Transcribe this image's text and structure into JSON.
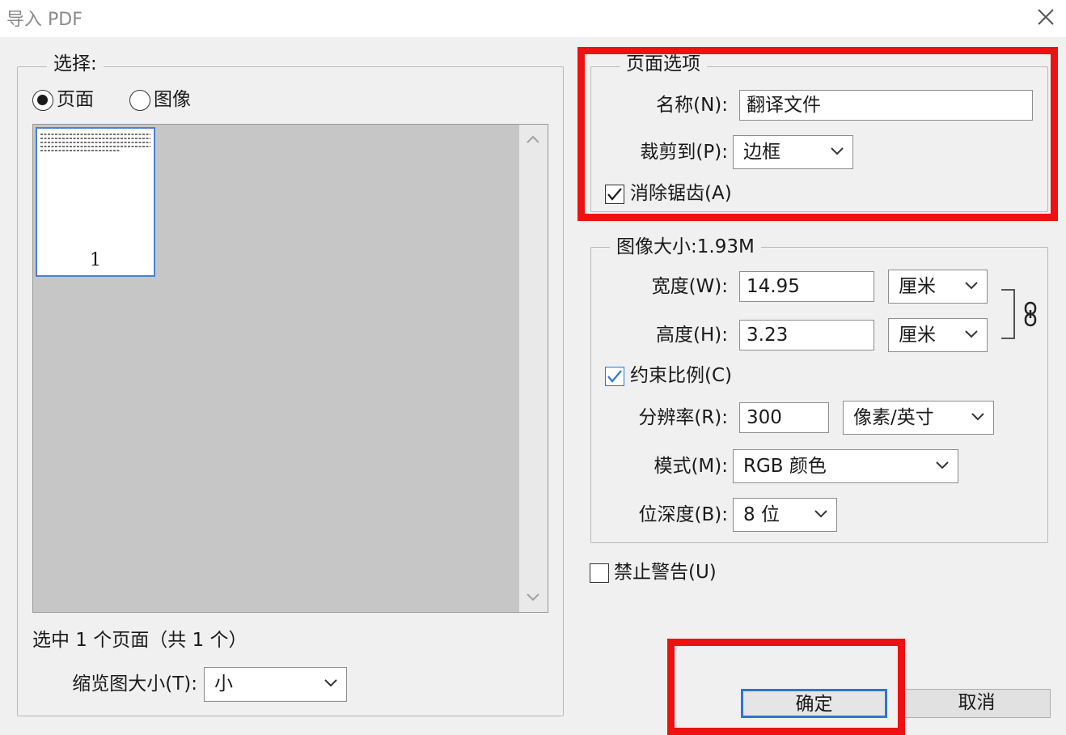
{
  "window": {
    "title": "导入 PDF"
  },
  "select_group": {
    "legend": "选择:",
    "options": [
      {
        "label": "页面",
        "checked": true
      },
      {
        "label": "图像",
        "checked": false
      }
    ],
    "thumbnails": [
      {
        "page": "1",
        "selected": true
      }
    ],
    "selection_status": "选中 1 个页面（共 1 个）",
    "thumbnail_size": {
      "label": "缩览图大小(T):",
      "value": "小"
    }
  },
  "page_options": {
    "legend": "页面选项",
    "name": {
      "label": "名称(N):",
      "value": "翻译文件"
    },
    "crop_to": {
      "label": "裁剪到(P):",
      "value": "边框"
    },
    "anti_alias": {
      "label": "消除锯齿(A)",
      "checked": true
    }
  },
  "image_size": {
    "legend": "图像大小:1.93M",
    "width": {
      "label": "宽度(W):",
      "value": "14.95",
      "unit": "厘米"
    },
    "height": {
      "label": "高度(H):",
      "value": "3.23",
      "unit": "厘米"
    },
    "constrain": {
      "label": "约束比例(C)",
      "checked": true
    },
    "resolution": {
      "label": "分辨率(R):",
      "value": "300",
      "unit": "像素/英寸"
    },
    "mode": {
      "label": "模式(M):",
      "value": "RGB 颜色"
    },
    "bit_depth": {
      "label": "位深度(B):",
      "value": "8 位"
    }
  },
  "suppress_warnings": {
    "label": "禁止警告(U)",
    "checked": false
  },
  "buttons": {
    "ok": "确定",
    "cancel": "取消"
  },
  "icons": {
    "close": "close-icon",
    "chevron": "chevron-down-icon",
    "link": "chain-link-icon"
  },
  "colors": {
    "highlight_red": "#ee1111",
    "focus_blue": "#2f74d0",
    "thumbnail_border": "#4a7fd4"
  }
}
